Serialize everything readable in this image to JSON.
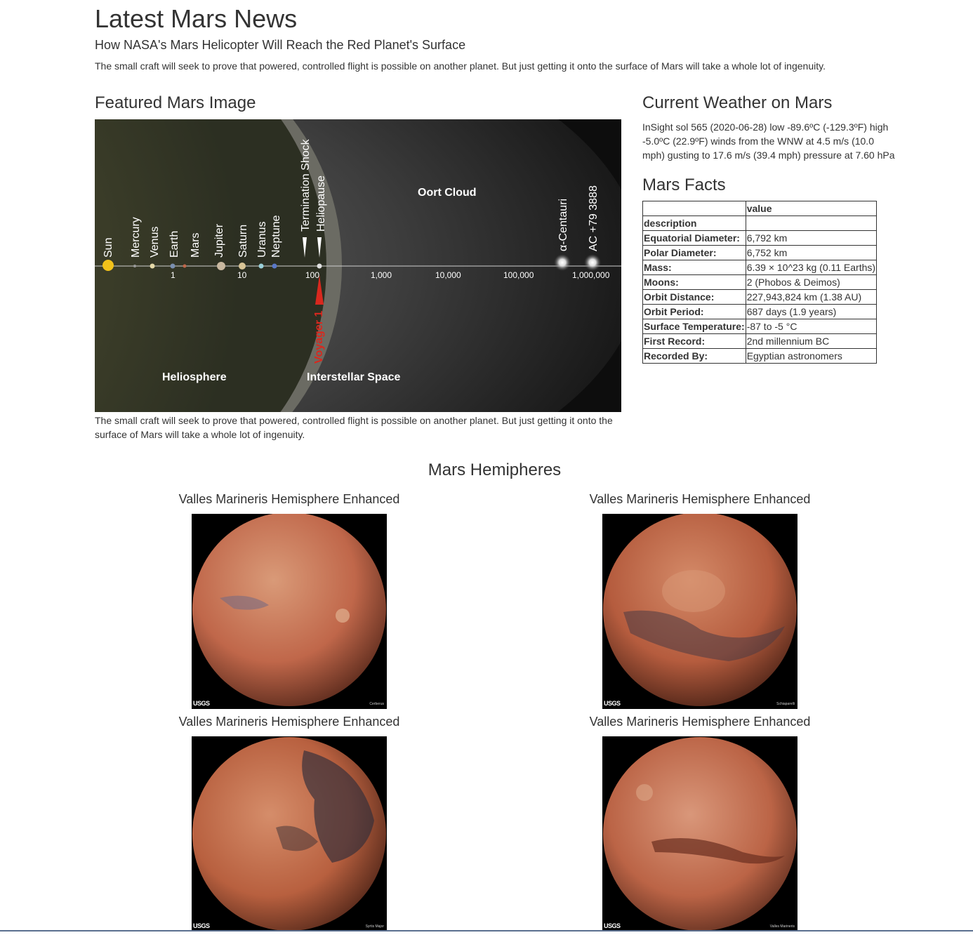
{
  "news": {
    "section_title": "Latest Mars News",
    "headline": "How NASA's Mars Helicopter Will Reach the Red Planet's Surface",
    "teaser": "The small craft will seek to prove that powered, controlled flight is possible on another planet. But just getting it onto the surface of Mars will take a whole lot of ingenuity."
  },
  "featured": {
    "section_title": "Featured Mars Image",
    "caption": "The small craft will seek to prove that powered, controlled flight is possible on another planet. But just getting it onto the surface of Mars will take a whole lot of ingenuity.",
    "image_labels": {
      "sun": "Sun",
      "mercury": "Mercury",
      "venus": "Venus",
      "earth": "Earth",
      "mars": "Mars",
      "jupiter": "Jupiter",
      "saturn": "Saturn",
      "uranus": "Uranus",
      "neptune": "Neptune",
      "termination_shock": "Termination Shock",
      "heliopause": "Heliopause",
      "oort_cloud": "Oort Cloud",
      "alpha_centauri": "α-Centauri",
      "ac79": "AC +79 3888",
      "voyager": "Voyager 1",
      "heliosphere": "Heliosphere",
      "interstellar": "Interstellar Space",
      "tick_1": "1",
      "tick_10": "10",
      "tick_100": "100",
      "tick_1000": "1,000",
      "tick_10000": "10,000",
      "tick_100000": "100,000",
      "tick_1000000": "1,000,000"
    }
  },
  "weather": {
    "section_title": "Current Weather on Mars",
    "text": "InSight sol 565 (2020-06-28) low -89.6ºC (-129.3ºF) high -5.0ºC (22.9ºF) winds from the WNW at 4.5 m/s (10.0 mph) gusting to 17.6 m/s (39.4 mph) pressure at 7.60 hPa"
  },
  "facts": {
    "section_title": "Mars Facts",
    "header_value": "value",
    "header_index": "description",
    "rows": [
      {
        "label": "Equatorial Diameter:",
        "value": "6,792 km"
      },
      {
        "label": "Polar Diameter:",
        "value": "6,752 km"
      },
      {
        "label": "Mass:",
        "value": "6.39 × 10^23 kg (0.11 Earths)"
      },
      {
        "label": "Moons:",
        "value": "2 (Phobos & Deimos)"
      },
      {
        "label": "Orbit Distance:",
        "value": "227,943,824 km (1.38 AU)"
      },
      {
        "label": "Orbit Period:",
        "value": "687 days (1.9 years)"
      },
      {
        "label": "Surface Temperature:",
        "value": "-87 to -5 °C"
      },
      {
        "label": "First Record:",
        "value": "2nd millennium BC"
      },
      {
        "label": "Recorded By:",
        "value": "Egyptian astronomers"
      }
    ]
  },
  "hemispheres": {
    "section_title": "Mars Hemipheres",
    "items": [
      {
        "title": "Valles Marineris Hemisphere Enhanced",
        "logo": "USGS",
        "img_label": "Cerberus"
      },
      {
        "title": "Valles Marineris Hemisphere Enhanced",
        "logo": "USGS",
        "img_label": "Schiaparelli"
      },
      {
        "title": "Valles Marineris Hemisphere Enhanced",
        "logo": "USGS",
        "img_label": "Syrtis Major"
      },
      {
        "title": "Valles Marineris Hemisphere Enhanced",
        "logo": "USGS",
        "img_label": "Valles Marineris"
      }
    ]
  },
  "colors": {
    "text": "#333333",
    "mars_base": "#c0674a",
    "voyager_arrow": "#d9281e"
  }
}
